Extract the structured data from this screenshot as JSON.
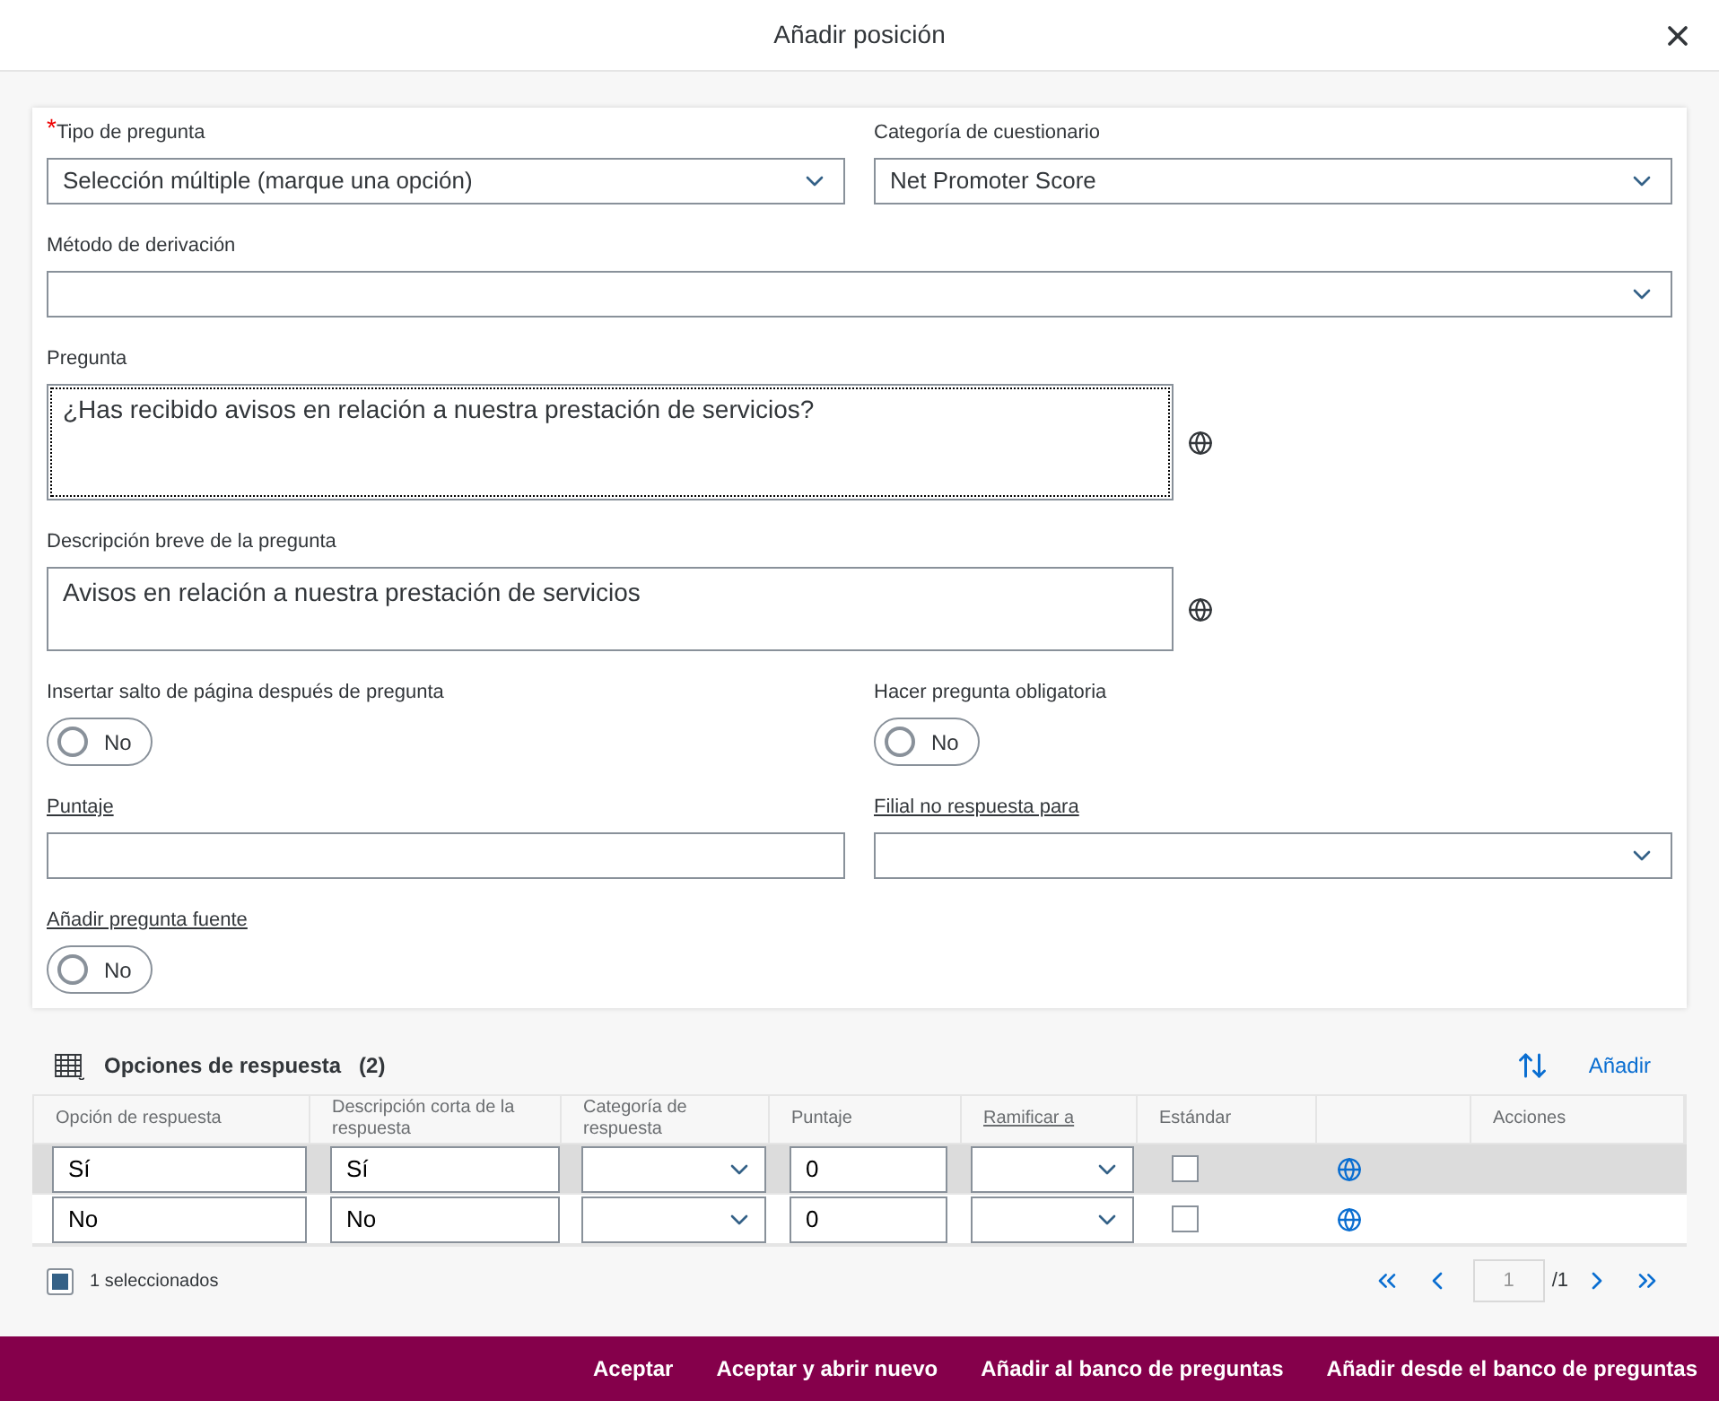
{
  "dialog": {
    "title": "Añadir posición"
  },
  "form": {
    "rows": [
      [
        {
          "kind": "select",
          "label": "Tipo de pregunta",
          "required_mark": "*",
          "value": "Selección múltiple (marque una opción)"
        },
        {
          "kind": "select",
          "label": "Categoría de cuestionario",
          "value": "Net Promoter Score"
        }
      ],
      [
        {
          "kind": "select",
          "label": "Método de derivación"
        }
      ],
      [
        {
          "kind": "textarea",
          "label": "Pregunta",
          "value": "¿Has recibido avisos en relación a nuestra prestación de servicios?",
          "focused": true,
          "translatable": true,
          "tall": true
        }
      ],
      [
        {
          "kind": "textarea",
          "label": "Descripción breve de la pregunta",
          "value": "Avisos en relación a nuestra prestación de servicios",
          "translatable": true
        }
      ],
      [
        {
          "kind": "toggle",
          "label": "Insertar salto de página después de pregunta",
          "on": false,
          "text": "No"
        },
        {
          "kind": "toggle",
          "label": "Hacer pregunta obligatoria",
          "on": false,
          "text": "No"
        }
      ],
      [
        {
          "kind": "input",
          "label": "Puntaje",
          "link": true
        },
        {
          "kind": "select",
          "label": "Filial no respuesta para",
          "link": true
        }
      ],
      [
        {
          "kind": "toggle",
          "label": "Añadir pregunta fuente",
          "link": true,
          "on": false,
          "text": "No"
        }
      ]
    ]
  },
  "answers": {
    "title": "Opciones de respuesta",
    "count": "(2)",
    "add": "Añadir",
    "columns": [
      {
        "label": "Opción de respuesta"
      },
      {
        "label": "Descripción corta de la respuesta"
      },
      {
        "label": "Categoría de respuesta"
      },
      {
        "label": "Puntaje"
      },
      {
        "label": "Ramificar a",
        "link": true
      },
      {
        "label": "Estándar"
      },
      {
        "label": "Acciones"
      }
    ],
    "rows": [
      {
        "selected": true,
        "option": "Sí",
        "description": "Sí",
        "score": "0",
        "standard": false
      },
      {
        "selected": false,
        "option": "No",
        "description": "No",
        "score": "0",
        "standard": false
      }
    ],
    "selection": "1 seleccionados",
    "page": "1",
    "total": "/1"
  },
  "footer_buttons": [
    "Aceptar",
    "Aceptar y abrir nuevo",
    "Añadir al banco de preguntas",
    "Añadir desde el banco de preguntas"
  ]
}
